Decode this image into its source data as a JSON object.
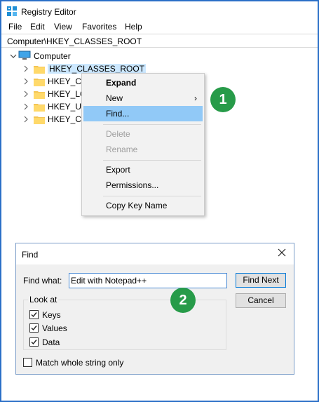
{
  "window": {
    "title": "Registry Editor",
    "app_icon": "registry-editor-icon"
  },
  "menubar": {
    "items": [
      "File",
      "Edit",
      "View",
      "Favorites",
      "Help"
    ]
  },
  "address": {
    "path": "Computer\\HKEY_CLASSES_ROOT"
  },
  "tree": {
    "root": "Computer",
    "items": [
      "HKEY_CLASSES_ROOT",
      "HKEY_CUR",
      "HKEY_LOC",
      "HKEY_USE",
      "HKEY_CUR"
    ]
  },
  "context_menu": {
    "expand": "Expand",
    "new": "New",
    "find": "Find...",
    "delete": "Delete",
    "rename": "Rename",
    "export": "Export",
    "permissions": "Permissions...",
    "copy_key_name": "Copy Key Name"
  },
  "badges": {
    "one": "1",
    "two": "2",
    "color": "#279b49"
  },
  "find_dialog": {
    "title": "Find",
    "find_what_label": "Find what:",
    "find_what_value": "Edit with Notepad++",
    "find_next": "Find Next",
    "cancel": "Cancel",
    "look_at": "Look at",
    "keys": "Keys",
    "values": "Values",
    "data": "Data",
    "match_whole": "Match whole string only",
    "keys_checked": true,
    "values_checked": true,
    "data_checked": true,
    "match_whole_checked": false
  },
  "colors": {
    "frame": "#2b6fc7",
    "selection": "#cce8ff",
    "menu_hover": "#91c9f7"
  }
}
